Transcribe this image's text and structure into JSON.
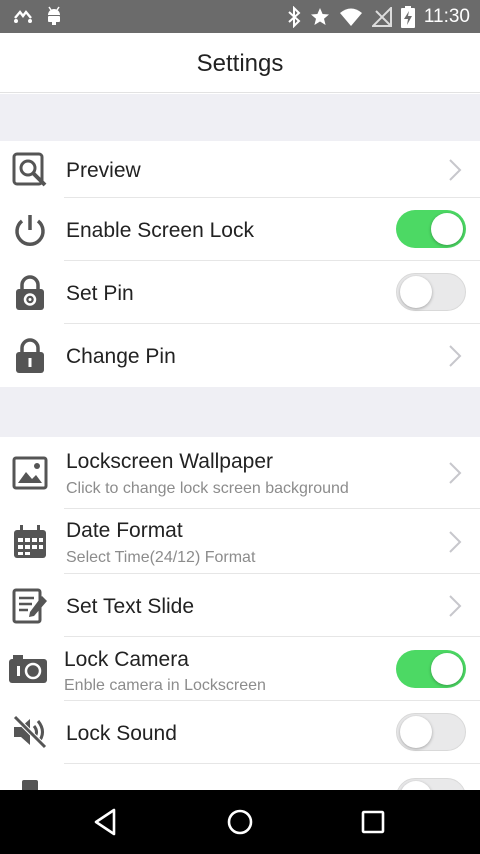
{
  "status_bar": {
    "time": "11:30",
    "left_icons": [
      "notification-icon",
      "android-icon"
    ],
    "right_icons": [
      "bluetooth-icon",
      "star-icon",
      "wifi-icon",
      "no-signal-icon",
      "battery-charging-icon"
    ]
  },
  "header": {
    "title": "Settings"
  },
  "items": [
    {
      "label": "Preview",
      "icon": "preview-icon",
      "control": "chevron"
    },
    {
      "label": "Enable Screen Lock",
      "icon": "power-icon",
      "control": "toggle",
      "on": true
    },
    {
      "label": "Set Pin",
      "icon": "lock-settings-icon",
      "control": "toggle",
      "on": false
    },
    {
      "label": "Change Pin",
      "icon": "lock-icon",
      "control": "chevron"
    },
    {
      "label": "Lockscreen Wallpaper",
      "sub": "Click to change lock screen background",
      "icon": "wallpaper-icon",
      "control": "chevron"
    },
    {
      "label": "Date Format",
      "sub": "Select Time(24/12) Format",
      "icon": "calendar-icon",
      "control": "chevron"
    },
    {
      "label": "Set Text Slide",
      "icon": "edit-text-icon",
      "control": "chevron"
    },
    {
      "label": "Lock Camera",
      "sub": "Enble camera in Lockscreen",
      "icon": "camera-icon",
      "control": "toggle",
      "on": true
    },
    {
      "label": "Lock Sound",
      "icon": "sound-off-icon",
      "control": "toggle",
      "on": false
    }
  ],
  "colors": {
    "toggle_on": "#4cd964",
    "section_gap": "#efeff4",
    "status_bar": "#6b6b6b"
  }
}
